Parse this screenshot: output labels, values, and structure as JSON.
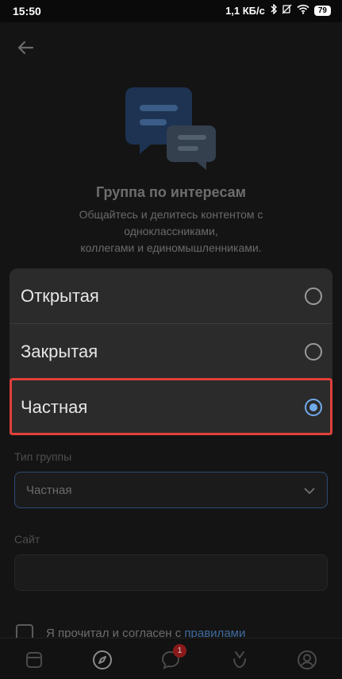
{
  "status_bar": {
    "time": "15:50",
    "network_speed": "1,1 КБ/с",
    "battery": "79"
  },
  "header": {
    "back_icon": "arrow-left-icon"
  },
  "hero": {
    "icon": "chat-bubbles-icon",
    "title": "Группа по интересам",
    "description_lines": [
      "Общайтесь и делитесь контентом с",
      "одноклассниками,",
      "коллегами и единомышленниками."
    ]
  },
  "form": {
    "group_type_label": "Тип группы",
    "group_type_value": "Частная",
    "site_label": "Сайт",
    "site_value": "",
    "agree_text": "Я прочитал и согласен с",
    "agree_link": "правилами"
  },
  "sheet": {
    "options": [
      {
        "label": "Открытая",
        "selected": false
      },
      {
        "label": "Закрытая",
        "selected": false
      },
      {
        "label": "Частная",
        "selected": true
      }
    ]
  },
  "tab_bar": {
    "items": [
      {
        "icon": "feed-icon"
      },
      {
        "icon": "compass-icon"
      },
      {
        "icon": "messages-icon",
        "badge": "1"
      },
      {
        "icon": "clips-icon"
      },
      {
        "icon": "profile-icon"
      }
    ]
  },
  "colors": {
    "accent": "#71aaeb",
    "highlight": "#e0403a"
  }
}
